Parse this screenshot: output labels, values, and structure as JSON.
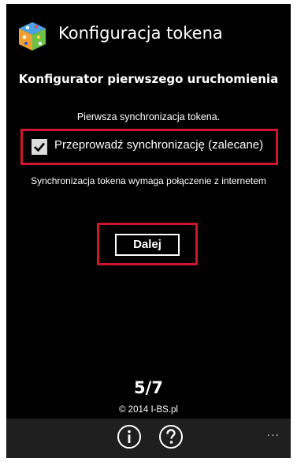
{
  "header": {
    "title": "Konfiguracja tokena",
    "icon": "app-cube-icon"
  },
  "wizard": {
    "heading": "Konfigurator pierwszego uruchomienia",
    "subtitle": "Pierwsza synchronizacja tokena.",
    "sync_option": {
      "label": "Przeprowadź synchronizację (zalecane)",
      "checked": true
    },
    "note": "Synchronizacja tokena wymaga połączenie z internetem",
    "next_label": "Dalej",
    "step": "5/7",
    "copyright": "© 2014 I-BS.pl"
  },
  "app_bar": {
    "info_icon": "info-icon",
    "help_icon": "help-icon",
    "more_label": "..."
  },
  "colors": {
    "background": "#000000",
    "text": "#ffffff",
    "highlight": "#d0162d",
    "app_bar": "#1f1f1f"
  }
}
